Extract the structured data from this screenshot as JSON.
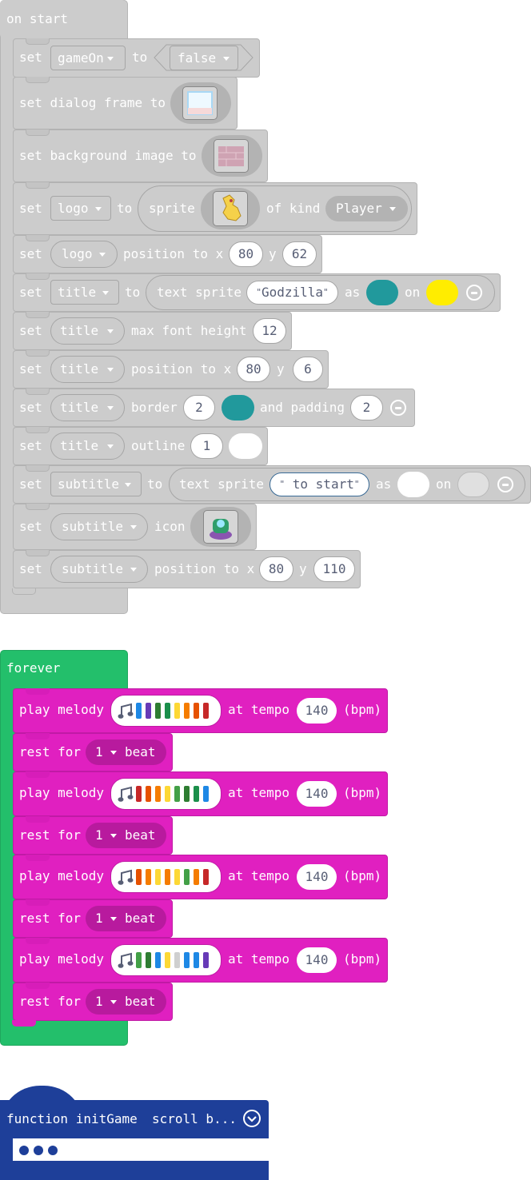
{
  "on_start": {
    "header": "on start",
    "set_kw": "set",
    "to_kw": "to",
    "b1": {
      "var": "gameOn",
      "value": "false"
    },
    "b2": {
      "label": "set dialog frame to"
    },
    "b3": {
      "label": "set background image to"
    },
    "b4": {
      "var": "logo",
      "sprite_kw": "sprite",
      "of_kind_kw": "of kind",
      "kind": "Player"
    },
    "b5": {
      "var": "logo",
      "pos_kw": "position to x",
      "x": "80",
      "y_kw": "y",
      "y": "62"
    },
    "b6": {
      "var": "title",
      "text_sprite_kw": "text sprite",
      "text": "Godzilla",
      "as_kw": "as",
      "on_kw": "on",
      "fg_color": "#21999c",
      "bg_color": "#ffed00"
    },
    "b7": {
      "var": "title",
      "label": "max font height",
      "value": "12"
    },
    "b8": {
      "var": "title",
      "pos_kw": "position to x",
      "x": "80",
      "y_kw": "y",
      "y": "6"
    },
    "b9": {
      "var": "title",
      "border_kw": "border",
      "border": "2",
      "and_padding_kw": "and padding",
      "padding": "2",
      "border_color": "#21999c"
    },
    "b10": {
      "var": "title",
      "outline_kw": "outline",
      "outline": "1",
      "outline_color": "#ffffff"
    },
    "b11": {
      "var": "subtitle",
      "text_sprite_kw": "text sprite",
      "text": " to start",
      "as_kw": "as",
      "on_kw": "on",
      "fg_color": "#ffffff",
      "bg_color": "#e0e0e0"
    },
    "b12": {
      "var": "subtitle",
      "icon_kw": "icon"
    },
    "b13": {
      "var": "subtitle",
      "pos_kw": "position to x",
      "x": "80",
      "y_kw": "y",
      "y": "110"
    }
  },
  "forever": {
    "header": "forever",
    "play_kw": "play melody",
    "tempo_kw": "at tempo",
    "bpm_kw": "(bpm)",
    "rest_kw": "rest for",
    "beat_kw": "beat",
    "melodies": [
      {
        "tempo": "140",
        "rest": "1",
        "colors": [
          "#1e88e5",
          "#673ab7",
          "#2e7d32",
          "#1b8f4b",
          "#fdd835",
          "#f57c00",
          "#e65100",
          "#c62828"
        ]
      },
      {
        "tempo": "140",
        "rest": "1",
        "colors": [
          "#c62828",
          "#e65100",
          "#f57c00",
          "#fdd835",
          "#43a047",
          "#2e7d32",
          "#1b8f4b",
          "#1e88e5"
        ]
      },
      {
        "tempo": "140",
        "rest": "1",
        "colors": [
          "#e65100",
          "#f57c00",
          "#fdd835",
          "#f57c00",
          "#fdd835",
          "#43a047",
          "#f57c00",
          "#c62828"
        ]
      },
      {
        "tempo": "140",
        "rest": "1",
        "colors": [
          "#43a047",
          "#2e7d32",
          "#1e88e5",
          "#fdd835",
          "#cfcfcf",
          "#1e88e5",
          "#1e88e5",
          "#673ab7"
        ]
      }
    ]
  },
  "function_block": {
    "title": "function initGame",
    "scroll_text": "scroll b...",
    "brand_color": "#1e3f99"
  }
}
